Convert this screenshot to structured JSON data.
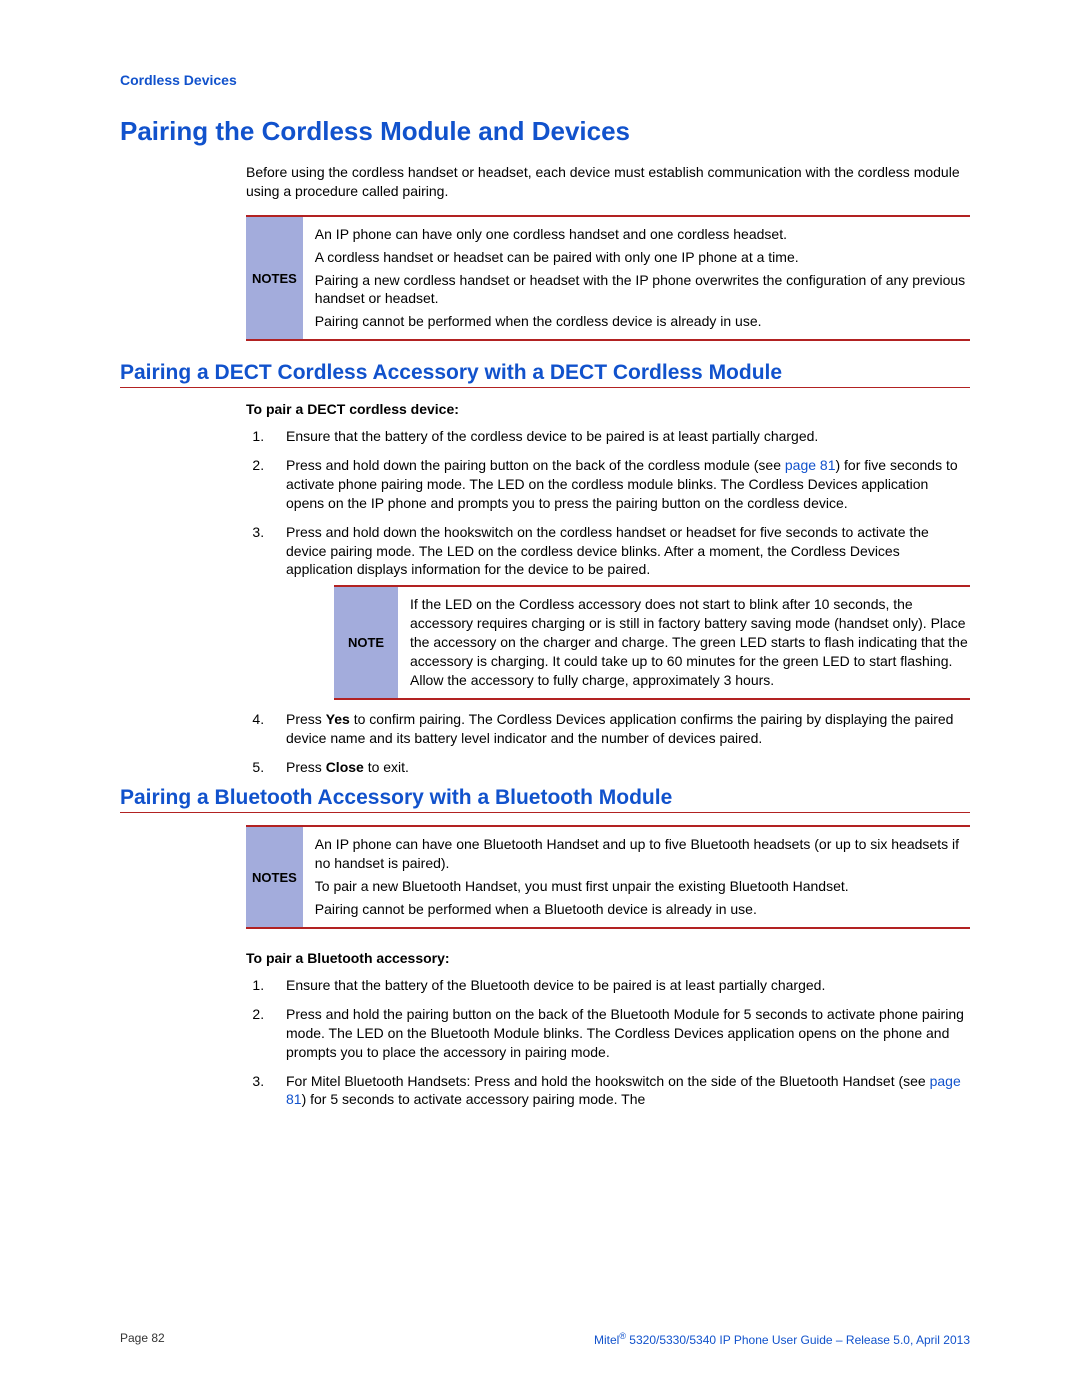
{
  "header": {
    "section": "Cordless Devices"
  },
  "h1": "Pairing the Cordless Module and Devices",
  "intro": "Before using the cordless handset or headset, each device must establish communication with the cordless module using a procedure called pairing.",
  "notes1": {
    "label": "NOTES",
    "items": [
      "An IP phone can have only one cordless handset and one cordless headset.",
      "A cordless handset or headset can be paired with only one IP phone at a time.",
      "Pairing a new cordless handset or headset with the IP phone overwrites the configuration of any previous handset or headset.",
      "Pairing cannot be performed when the cordless device is already in use."
    ]
  },
  "section_dect": {
    "h2": "Pairing a DECT Cordless Accessory with a DECT Cordless Module",
    "sub": "To pair a DECT cordless device:",
    "steps": {
      "s1": "Ensure that the battery of the cordless device to be paired is at least partially charged.",
      "s2a": "Press and hold down the pairing button on the back of the cordless module (see ",
      "s2link": "page 81",
      "s2b": ") for five seconds to activate phone pairing mode. The LED on the cordless module blinks. The Cordless Devices application opens on the IP phone and prompts you to press the pairing button on the cordless device.",
      "s3": "Press and hold down the hookswitch on the cordless handset or headset for five seconds to activate the device pairing mode. The LED on the cordless device blinks. After a moment, the Cordless Devices application displays information for the device to be paired.",
      "note_label": "NOTE",
      "note_text": "If the LED on the Cordless accessory does not start to blink after 10 seconds, the accessory requires charging or is still in factory battery saving mode (handset only). Place the accessory on the charger and charge. The green LED starts to flash indicating that the accessory is charging. It could take up to 60 minutes for the green LED to start flashing. Allow the accessory to fully charge, approximately 3 hours.",
      "s4a": "Press ",
      "s4bold1": "Yes",
      "s4b": " to confirm pairing. The Cordless Devices application confirms the pairing by displaying the paired device name and its battery level indicator and the number of devices paired.",
      "s5a": "Press ",
      "s5bold": "Close",
      "s5b": " to exit."
    }
  },
  "section_bt": {
    "h2": "Pairing a Bluetooth Accessory with a Bluetooth Module",
    "notes_label": "NOTES",
    "notes": [
      "An IP phone can have one Bluetooth Handset and up to five Bluetooth headsets (or up to six headsets if no handset is paired).",
      "To pair a new Bluetooth Handset, you must first unpair the existing Bluetooth Handset.",
      "Pairing cannot be performed when a Bluetooth device is already in use."
    ],
    "sub": "To pair a Bluetooth accessory:",
    "steps": {
      "s1": "Ensure that the battery of the Bluetooth device to be paired is at least partially charged.",
      "s2": "Press and hold the pairing button on the back of the Bluetooth Module for 5 seconds to activate phone pairing mode. The LED on the Bluetooth Module blinks. The Cordless Devices application opens on the phone and prompts you to place the accessory in pairing mode.",
      "s3a": "For Mitel Bluetooth Handsets: Press and hold the hookswitch on the side of the Bluetooth Handset (see ",
      "s3link": "page 81",
      "s3b": ") for 5 seconds to activate accessory pairing mode. The"
    }
  },
  "footer": {
    "left": "Page 82",
    "right_prefix": "Mitel",
    "right_sup": "®",
    "right_rest": " 5320/5330/5340 IP Phone User Guide – Release 5.0, April 2013"
  }
}
